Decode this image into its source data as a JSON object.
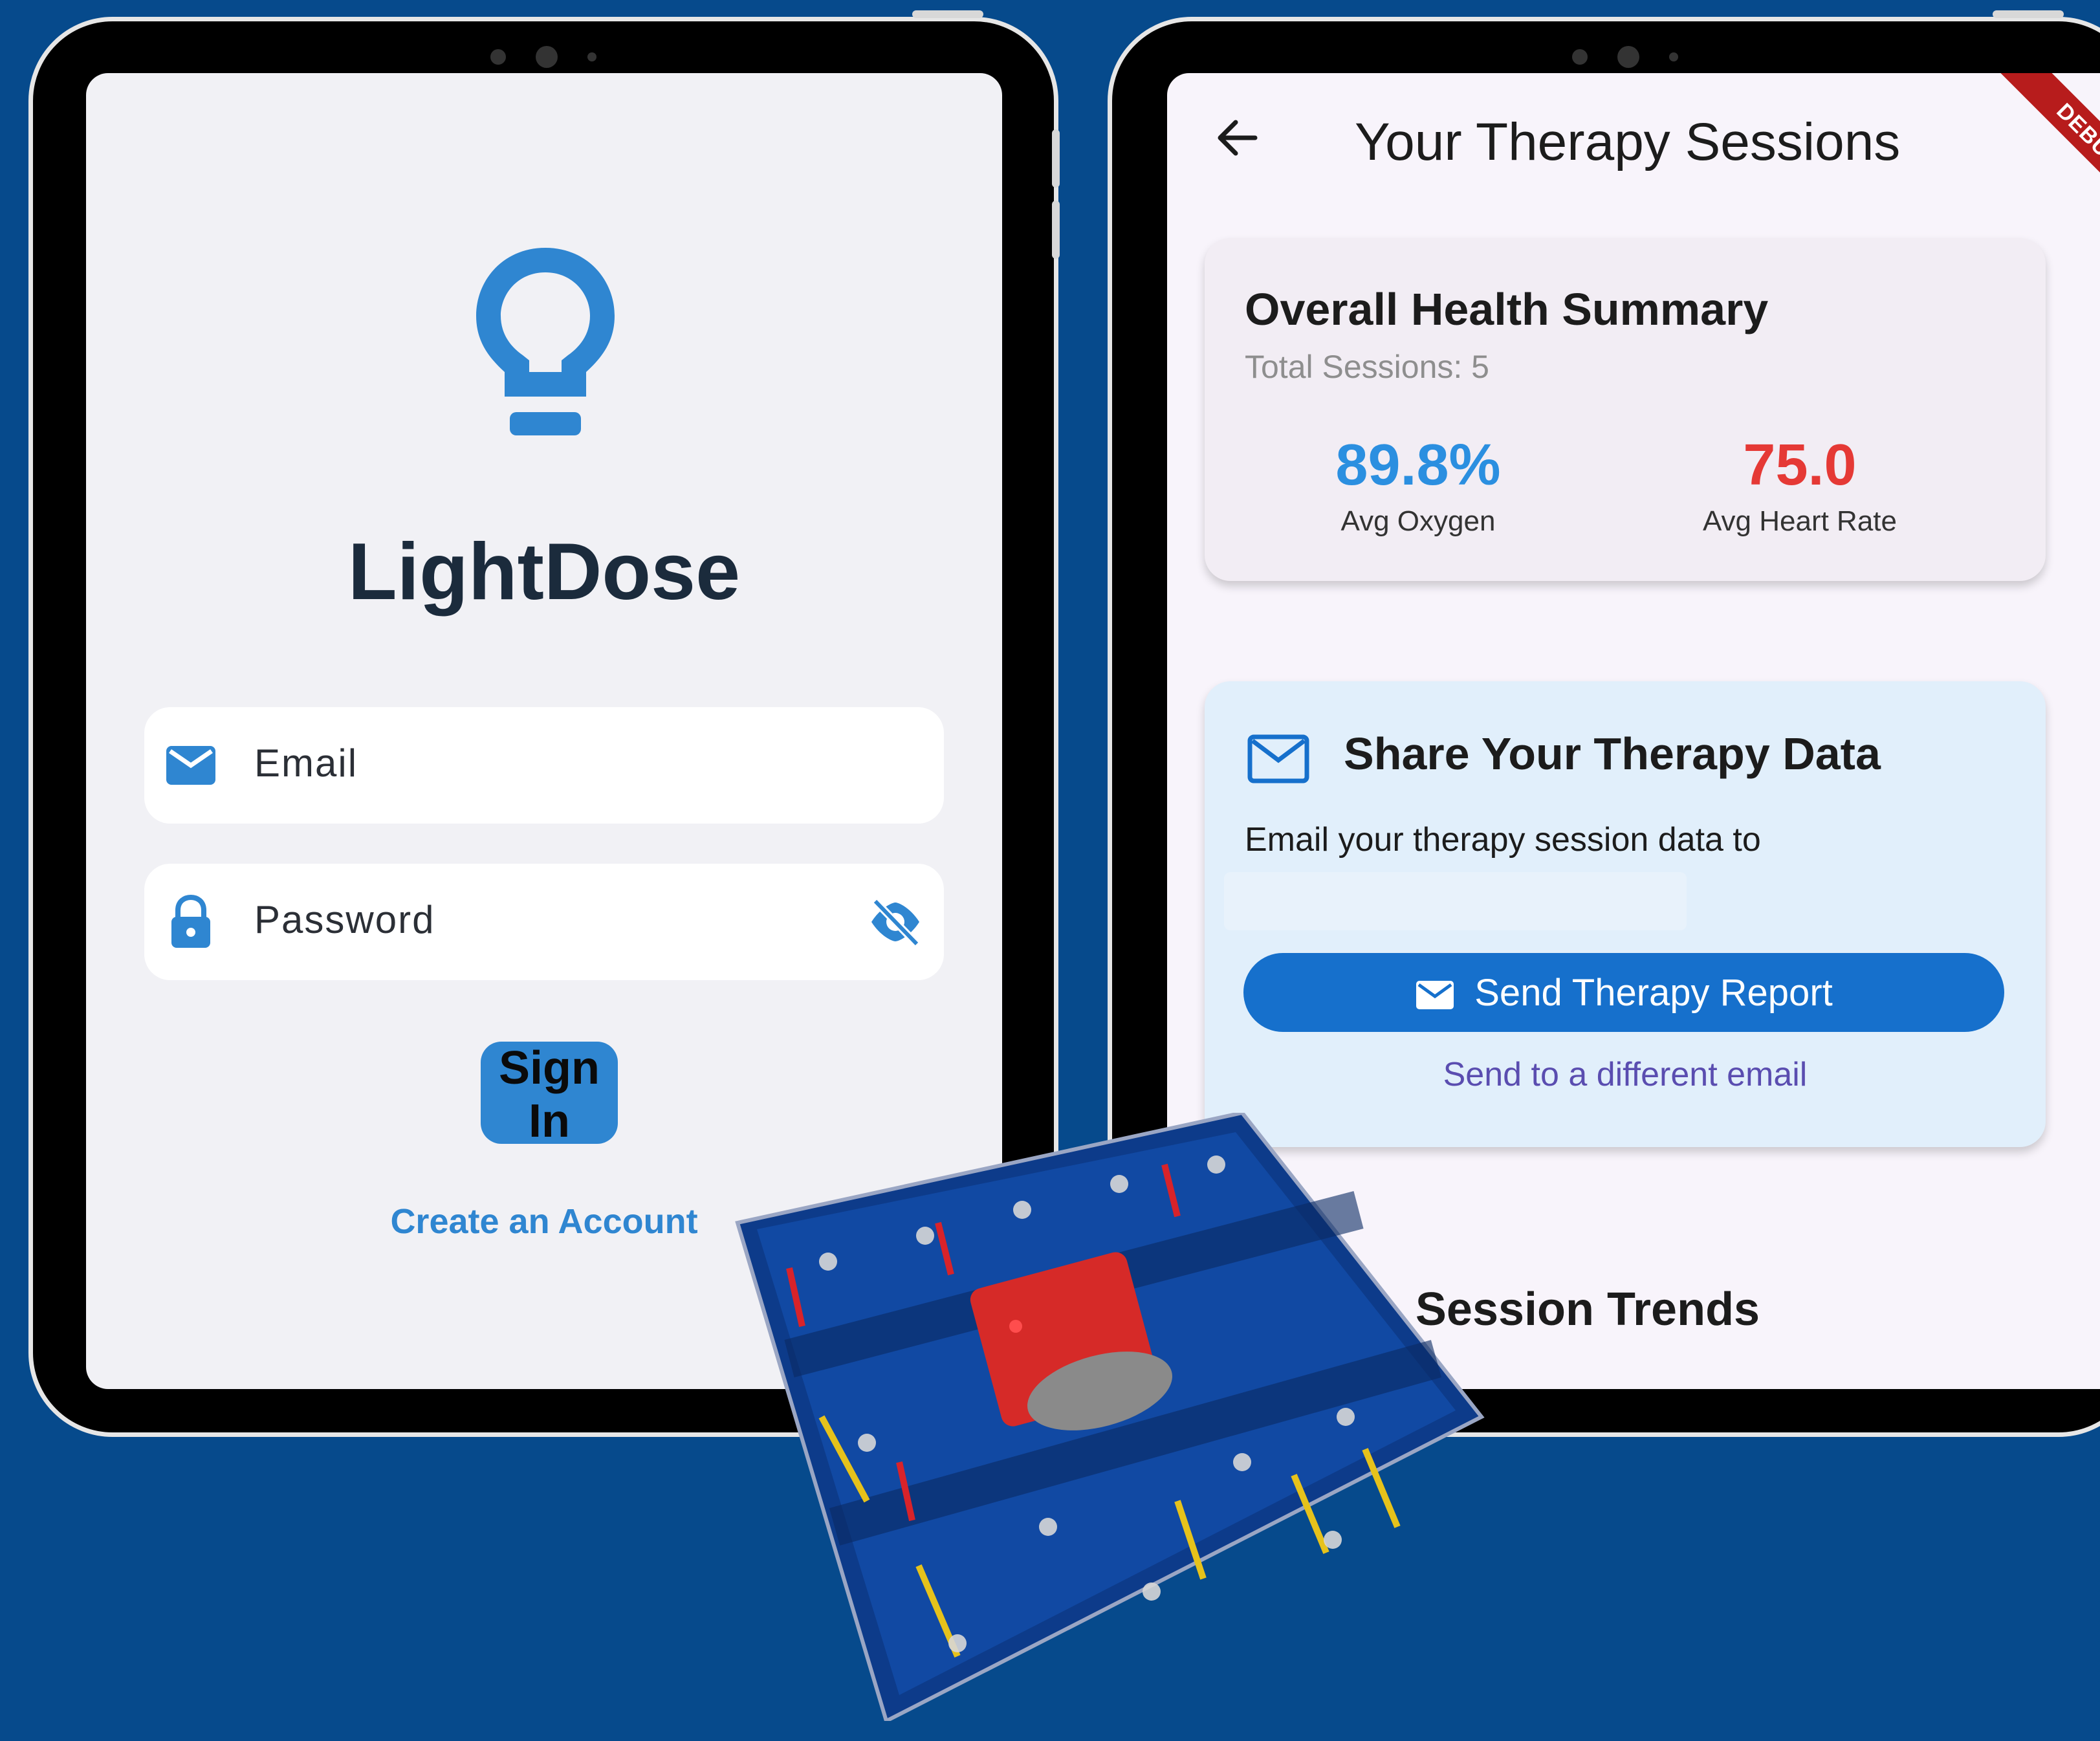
{
  "login": {
    "app_name": "LightDose",
    "email_placeholder": "Email",
    "password_placeholder": "Password",
    "sign_in": "Sign In",
    "create_account": "Create an Account"
  },
  "sessions": {
    "title": "Your Therapy Sessions",
    "debug_banner": "DEBUG",
    "summary": {
      "title": "Overall Health Summary",
      "total_sessions": "Total Sessions: 5",
      "avg_oxygen_value": "89.8%",
      "avg_oxygen_label": "Avg Oxygen",
      "avg_heart_value": "75.0",
      "avg_heart_label": "Avg Heart Rate"
    },
    "share": {
      "title": "Share Your Therapy Data",
      "text": "Email your therapy session data to",
      "send_button": "Send Therapy Report",
      "alt_link": "Send to a different email"
    },
    "trends_title": "Session Trends"
  },
  "colors": {
    "background": "#064a8c",
    "accent_blue": "#2f86d1",
    "oxygen_blue": "#2b8fe0",
    "heart_red": "#e53935",
    "button_blue": "#1670cc"
  },
  "icons": [
    "lightbulb-icon",
    "email-icon",
    "lock-icon",
    "eye-off-icon",
    "back-arrow-icon",
    "mail-outline-icon"
  ]
}
